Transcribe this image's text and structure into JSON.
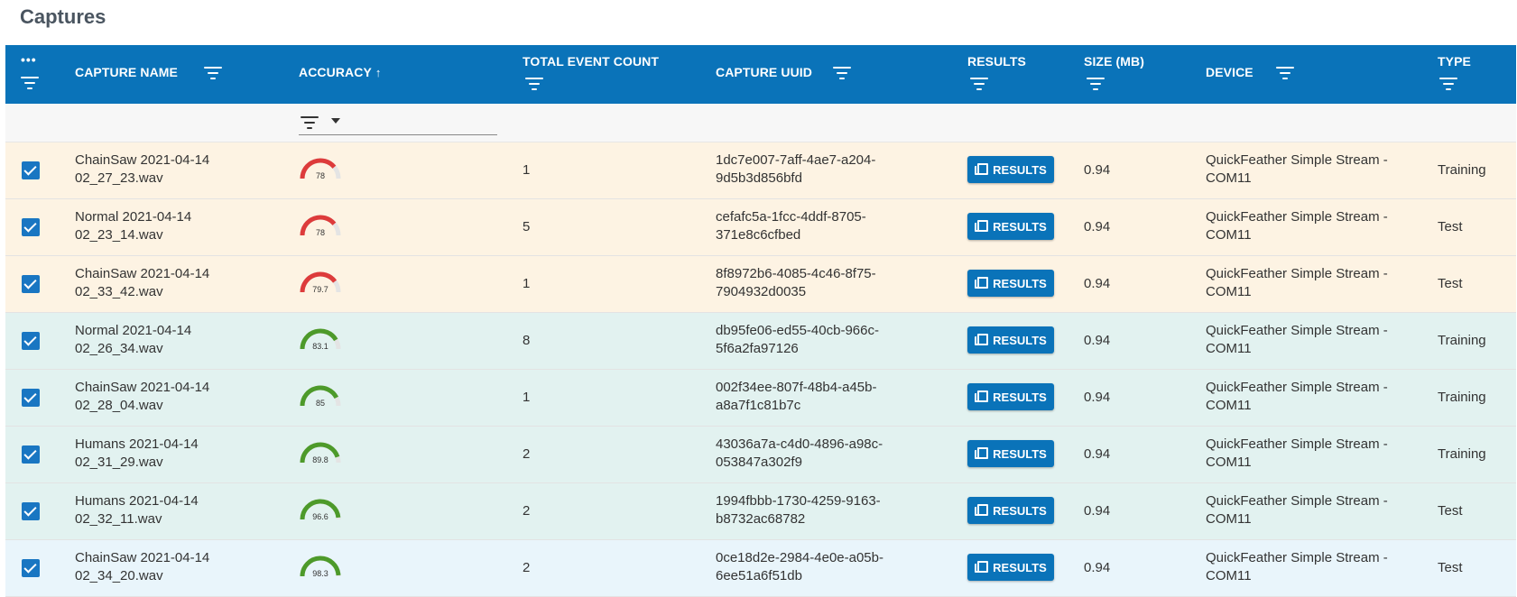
{
  "page": {
    "title": "Captures"
  },
  "columns": {
    "capture_name": "CAPTURE NAME",
    "accuracy": "ACCURACY",
    "accuracy_sort": "↑",
    "total_event_count": "TOTAL EVENT COUNT",
    "capture_uuid": "CAPTURE UUID",
    "results": "RESULTS",
    "size": "SIZE (MB)",
    "device": "DEVICE",
    "type": "TYPE"
  },
  "colors": {
    "header_bg": "#0a73b9",
    "row_orange": "#fdf3e3",
    "row_teal": "#e2f2f0",
    "row_blue": "#e9f5fb",
    "gauge_red": "#dd3b3b",
    "gauge_green": "#4d9a2a"
  },
  "rows": [
    {
      "checked": true,
      "name_line1": "ChainSaw 2021-04-14",
      "name_line2": "02_27_23.wav",
      "accuracy": "78",
      "accuracy_value": 78,
      "event_count": "1",
      "uuid_line1": "1dc7e007-7aff-4ae7-a204-",
      "uuid_line2": "9d5b3d856bfd",
      "results_label": "RESULTS",
      "size": "0.94",
      "device_line1": "QuickFeather Simple Stream -",
      "device_line2": "COM11",
      "type": "Training",
      "row_color": "orange"
    },
    {
      "checked": true,
      "name_line1": "Normal 2021-04-14",
      "name_line2": "02_23_14.wav",
      "accuracy": "78",
      "accuracy_value": 78,
      "event_count": "5",
      "uuid_line1": "cefafc5a-1fcc-4ddf-8705-",
      "uuid_line2": "371e8c6cfbed",
      "results_label": "RESULTS",
      "size": "0.94",
      "device_line1": "QuickFeather Simple Stream -",
      "device_line2": "COM11",
      "type": "Test",
      "row_color": "orange"
    },
    {
      "checked": true,
      "name_line1": "ChainSaw 2021-04-14",
      "name_line2": "02_33_42.wav",
      "accuracy": "79.7",
      "accuracy_value": 79.7,
      "event_count": "1",
      "uuid_line1": "8f8972b6-4085-4c46-8f75-",
      "uuid_line2": "7904932d0035",
      "results_label": "RESULTS",
      "size": "0.94",
      "device_line1": "QuickFeather Simple Stream -",
      "device_line2": "COM11",
      "type": "Test",
      "row_color": "orange"
    },
    {
      "checked": true,
      "name_line1": "Normal 2021-04-14",
      "name_line2": "02_26_34.wav",
      "accuracy": "83.1",
      "accuracy_value": 83.1,
      "event_count": "8",
      "uuid_line1": "db95fe06-ed55-40cb-966c-",
      "uuid_line2": "5f6a2fa97126",
      "results_label": "RESULTS",
      "size": "0.94",
      "device_line1": "QuickFeather Simple Stream -",
      "device_line2": "COM11",
      "type": "Training",
      "row_color": "teal"
    },
    {
      "checked": true,
      "name_line1": "ChainSaw 2021-04-14",
      "name_line2": "02_28_04.wav",
      "accuracy": "85",
      "accuracy_value": 85,
      "event_count": "1",
      "uuid_line1": "002f34ee-807f-48b4-a45b-",
      "uuid_line2": "a8a7f1c81b7c",
      "results_label": "RESULTS",
      "size": "0.94",
      "device_line1": "QuickFeather Simple Stream -",
      "device_line2": "COM11",
      "type": "Training",
      "row_color": "teal"
    },
    {
      "checked": true,
      "name_line1": "Humans 2021-04-14",
      "name_line2": "02_31_29.wav",
      "accuracy": "89.8",
      "accuracy_value": 89.8,
      "event_count": "2",
      "uuid_line1": "43036a7a-c4d0-4896-a98c-",
      "uuid_line2": "053847a302f9",
      "results_label": "RESULTS",
      "size": "0.94",
      "device_line1": "QuickFeather Simple Stream -",
      "device_line2": "COM11",
      "type": "Training",
      "row_color": "teal"
    },
    {
      "checked": true,
      "name_line1": "Humans 2021-04-14",
      "name_line2": "02_32_11.wav",
      "accuracy": "96.6",
      "accuracy_value": 96.6,
      "event_count": "2",
      "uuid_line1": "1994fbbb-1730-4259-9163-",
      "uuid_line2": "b8732ac68782",
      "results_label": "RESULTS",
      "size": "0.94",
      "device_line1": "QuickFeather Simple Stream -",
      "device_line2": "COM11",
      "type": "Test",
      "row_color": "teal"
    },
    {
      "checked": true,
      "name_line1": "ChainSaw 2021-04-14",
      "name_line2": "02_34_20.wav",
      "accuracy": "98.3",
      "accuracy_value": 98.3,
      "event_count": "2",
      "uuid_line1": "0ce18d2e-2984-4e0e-a05b-",
      "uuid_line2": "6ee51a6f51db",
      "results_label": "RESULTS",
      "size": "0.94",
      "device_line1": "QuickFeather Simple Stream -",
      "device_line2": "COM11",
      "type": "Test",
      "row_color": "blue"
    }
  ]
}
